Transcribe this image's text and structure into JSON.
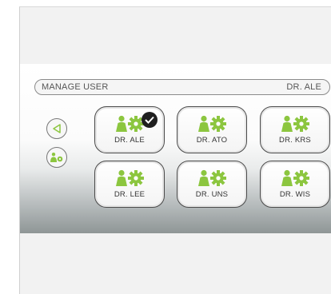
{
  "header": {
    "title": "MANAGE USER",
    "current_user": "DR. ALE"
  },
  "side_buttons": [
    {
      "icon": "back-triangle-icon"
    },
    {
      "icon": "user-settings-icon"
    }
  ],
  "users": [
    {
      "name": "DR. ALE",
      "selected": true
    },
    {
      "name": "DR. ATO",
      "selected": false
    },
    {
      "name": "DR. KRS",
      "selected": false
    },
    {
      "name": "DR. LEE",
      "selected": false
    },
    {
      "name": "DR. UNS",
      "selected": false
    },
    {
      "name": "DR. WIS",
      "selected": false
    }
  ],
  "colors": {
    "accent_green": "#8cc63f",
    "check_bg": "#1f1f1f"
  }
}
